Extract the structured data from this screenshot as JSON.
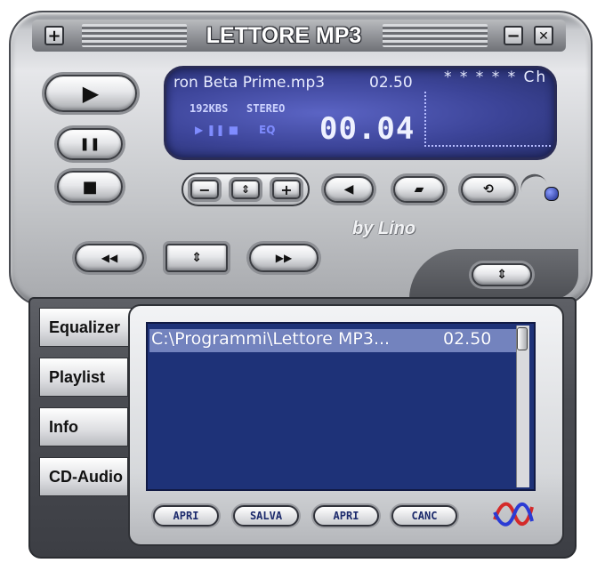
{
  "window": {
    "title": "LETTORE MP3",
    "add_button": "+",
    "minimize_button": "−",
    "close_button": "✕"
  },
  "display": {
    "track": "ron Beta Prime.mp3",
    "time": "02.50",
    "scroll_tail": "* * * * *  Ch",
    "bitrate": "192KBS",
    "stereo": "STEREO",
    "eq": "EQ",
    "counter": "00.04"
  },
  "controls": {
    "play": "▶",
    "pause": "❚❚",
    "stop": "■",
    "vol_minus": "−",
    "vol_mid": "⇕",
    "vol_plus": "+",
    "prev": "◀◀",
    "updown": "⇕",
    "next": "▶▶",
    "toggle": "⇕"
  },
  "brand": {
    "by_line": "by Lino"
  },
  "tabs": [
    {
      "label": "Equalizer"
    },
    {
      "label": "Playlist"
    },
    {
      "label": "Info"
    },
    {
      "label": "CD-Audio"
    }
  ],
  "playlist": {
    "items": [
      {
        "path": "C:\\Programmi\\Lettore MP3...",
        "time": "02.50"
      }
    ]
  },
  "footer_buttons": [
    {
      "label": "APRI"
    },
    {
      "label": "SALVA"
    },
    {
      "label": "APRI"
    },
    {
      "label": "CANC"
    }
  ],
  "colors": {
    "display_bg": "#3c4498",
    "playlist_bg": "#1e3278",
    "chrome": "#c8cacd"
  }
}
